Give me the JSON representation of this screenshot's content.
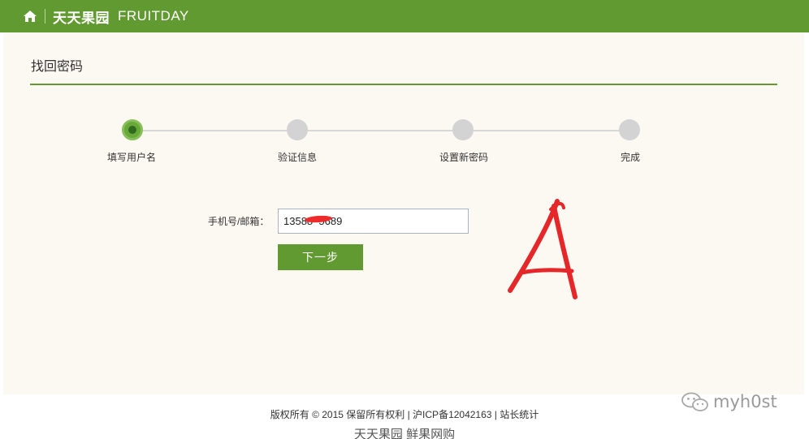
{
  "colors": {
    "brand_green": "#629a32",
    "panel_bg": "#fbf9f2",
    "inactive_dot": "#d3d3d3",
    "annotation_red": "#ee2b2b"
  },
  "header": {
    "icon": "home-icon",
    "brand_cn": "天天果园",
    "brand_en": "FRUITDAY"
  },
  "page": {
    "title": "找回密码"
  },
  "steps": [
    {
      "label": "填写用户名",
      "active": true
    },
    {
      "label": "验证信息",
      "active": false
    },
    {
      "label": "设置新密码",
      "active": false
    },
    {
      "label": "完成",
      "active": false
    }
  ],
  "form": {
    "label": "手机号/邮箱：",
    "value": "13588  5689",
    "next_label": "下一步"
  },
  "footer": {
    "copyright": "版权所有 © 2015 保留所有权利 | 沪ICP备12042163 | 站长统计",
    "brand": "天天果园 鲜果网购"
  },
  "watermark": {
    "icon": "wechat-icon",
    "text": "myh0st"
  }
}
